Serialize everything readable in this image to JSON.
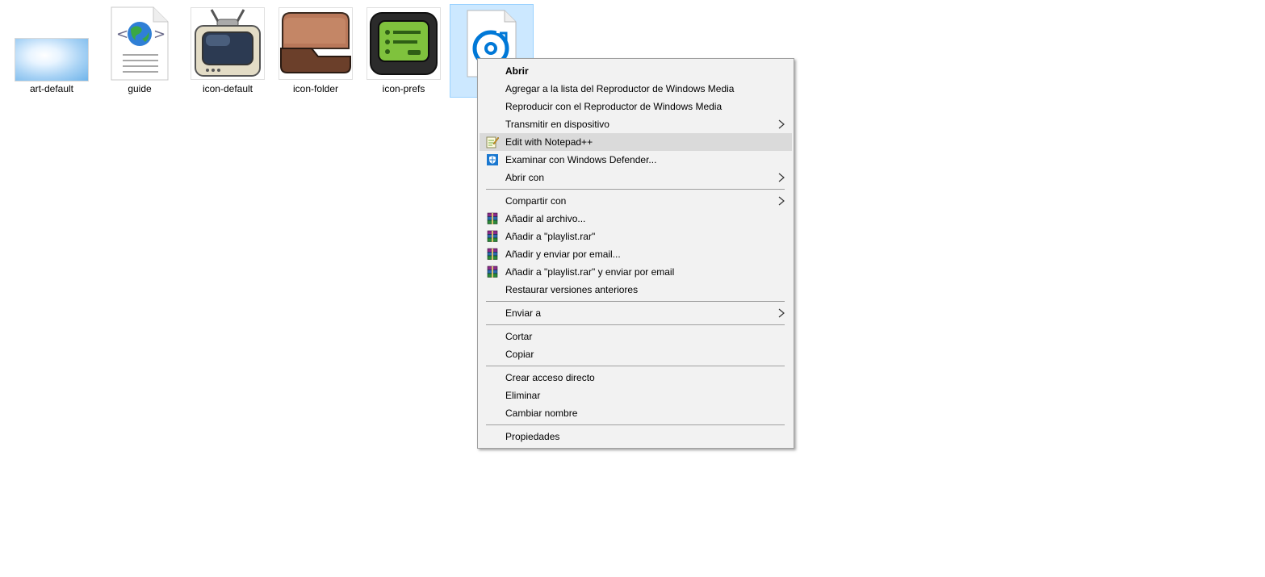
{
  "files": [
    {
      "name": "art-default",
      "icon": "sky-image-thumbnail"
    },
    {
      "name": "guide",
      "icon": "html-document-globe-icon"
    },
    {
      "name": "icon-default",
      "icon": "retro-tv-icon"
    },
    {
      "name": "icon-folder",
      "icon": "brown-folder-icon"
    },
    {
      "name": "icon-prefs",
      "icon": "green-screen-device-icon"
    },
    {
      "name": "",
      "icon": "media-playlist-file-icon",
      "selected": true
    }
  ],
  "context_menu": {
    "open": "Abrir",
    "add_to_wmp": "Agregar a la lista del Reproductor de Windows Media",
    "play_wmp": "Reproducir con el Reproductor de Windows Media",
    "cast": "Transmitir en dispositivo",
    "notepadpp": "Edit with Notepad++",
    "defender": "Examinar con Windows Defender...",
    "open_with": "Abrir con",
    "share": "Compartir con",
    "rar_add": "Añadir al archivo...",
    "rar_add_named": "Añadir a \"playlist.rar\"",
    "rar_email": "Añadir y enviar por email...",
    "rar_named_email": "Añadir a \"playlist.rar\" y enviar por email",
    "restore": "Restaurar versiones anteriores",
    "send_to": "Enviar a",
    "cut": "Cortar",
    "copy": "Copiar",
    "shortcut": "Crear acceso directo",
    "delete": "Eliminar",
    "rename": "Cambiar nombre",
    "properties": "Propiedades"
  },
  "colors": {
    "selection_bg": "#cce8ff",
    "selection_border": "#99d1ff",
    "menu_bg": "#f2f2f2",
    "menu_highlight": "#dadada",
    "wmp_blue": "#0078d7"
  }
}
